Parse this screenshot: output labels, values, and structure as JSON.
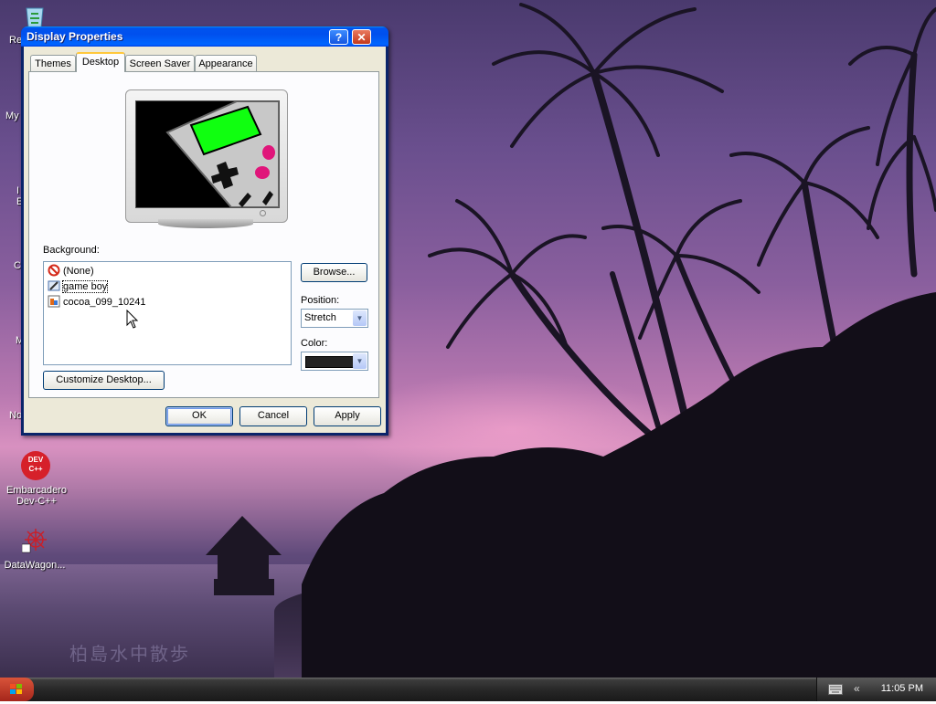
{
  "window": {
    "title": "Display Properties",
    "help_button": "?",
    "close_button": "✕",
    "tabs": [
      "Themes",
      "Desktop",
      "Screen Saver",
      "Appearance"
    ],
    "active_tab": "Desktop"
  },
  "desktop_tab": {
    "background_label": "Background:",
    "background_items": [
      "(None)",
      "game boy",
      "cocoa_099_10241"
    ],
    "selected_background": "game boy",
    "browse_button": "Browse...",
    "position_label": "Position:",
    "position_value": "Stretch",
    "color_label": "Color:",
    "color_value": "#222222",
    "customize_button": "Customize Desktop..."
  },
  "dialog_buttons": {
    "ok": "OK",
    "cancel": "Cancel",
    "apply": "Apply"
  },
  "desktop_icons": {
    "cut_labels": [
      "Re",
      "My",
      "I",
      "E",
      "C",
      "M",
      "No"
    ],
    "devcpp_badge": "DEV\nC++",
    "devcpp_label": "Embarcadero Dev-C++",
    "datawagon_label": "DataWagon..."
  },
  "wallpaper_watermark": "柏島水中散歩",
  "taskbar": {
    "clock": "11:05 PM",
    "chevron": "«"
  }
}
